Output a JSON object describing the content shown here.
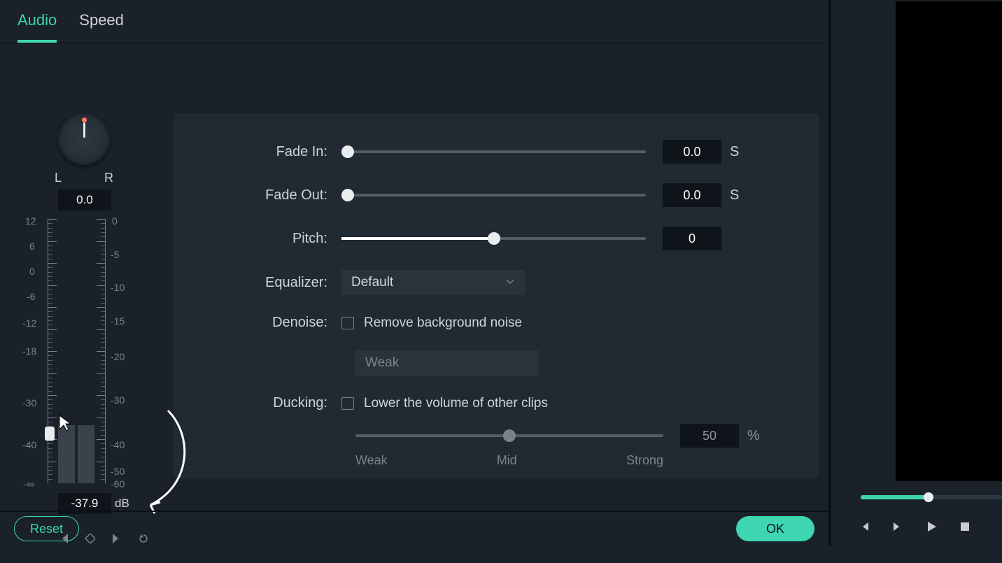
{
  "tabs": {
    "audio": "Audio",
    "speed": "Speed"
  },
  "active_tab": "audio",
  "pan": {
    "l": "L",
    "r": "R",
    "value": "0.0"
  },
  "volume": {
    "scale_left": [
      "12",
      "6",
      "0",
      "-6",
      "-12",
      "-18",
      "-30",
      "-40",
      "-∞"
    ],
    "scale_right": [
      "0",
      "-5",
      "-10",
      "-15",
      "-20",
      "-30",
      "-40",
      "-50",
      "-60"
    ],
    "value": "-37.9",
    "unit": "dB",
    "handle_percent": 82
  },
  "settings": {
    "fade_in": {
      "label": "Fade In:",
      "value": "0.0",
      "unit": "S",
      "percent": 0
    },
    "fade_out": {
      "label": "Fade Out:",
      "value": "0.0",
      "unit": "S",
      "percent": 0
    },
    "pitch": {
      "label": "Pitch:",
      "value": "0",
      "percent": 50
    },
    "equalizer": {
      "label": "Equalizer:",
      "selected": "Default"
    },
    "denoise": {
      "label": "Denoise:",
      "checkbox_label": "Remove background noise",
      "checked": false,
      "level": "Weak"
    },
    "ducking": {
      "label": "Ducking:",
      "checkbox_label": "Lower the volume of other clips",
      "checked": false,
      "value": "50",
      "unit": "%",
      "percent": 50,
      "marks": {
        "weak": "Weak",
        "mid": "Mid",
        "strong": "Strong"
      }
    }
  },
  "buttons": {
    "reset": "Reset",
    "ok": "OK"
  },
  "transport": {
    "progress_percent": 48
  }
}
